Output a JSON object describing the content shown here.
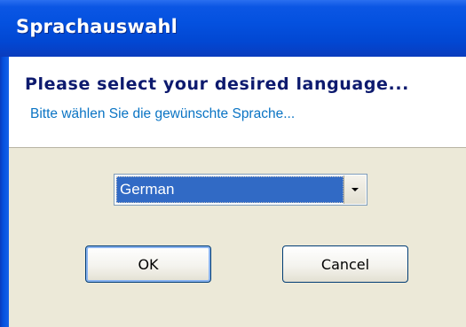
{
  "window": {
    "title": "Sprachauswahl"
  },
  "header": {
    "heading": "Please select your desired language...",
    "subheading": "Bitte wählen Sie die gewünschte Sprache..."
  },
  "language_select": {
    "selected_value": "German"
  },
  "buttons": {
    "ok_label": "OK",
    "cancel_label": "Cancel"
  },
  "colors": {
    "titlebar": "#0451df",
    "heading_text": "#0d1a6e",
    "subheading_text": "#0a74c4",
    "selection_highlight": "#316ac5",
    "dialog_background": "#ece9d8"
  }
}
